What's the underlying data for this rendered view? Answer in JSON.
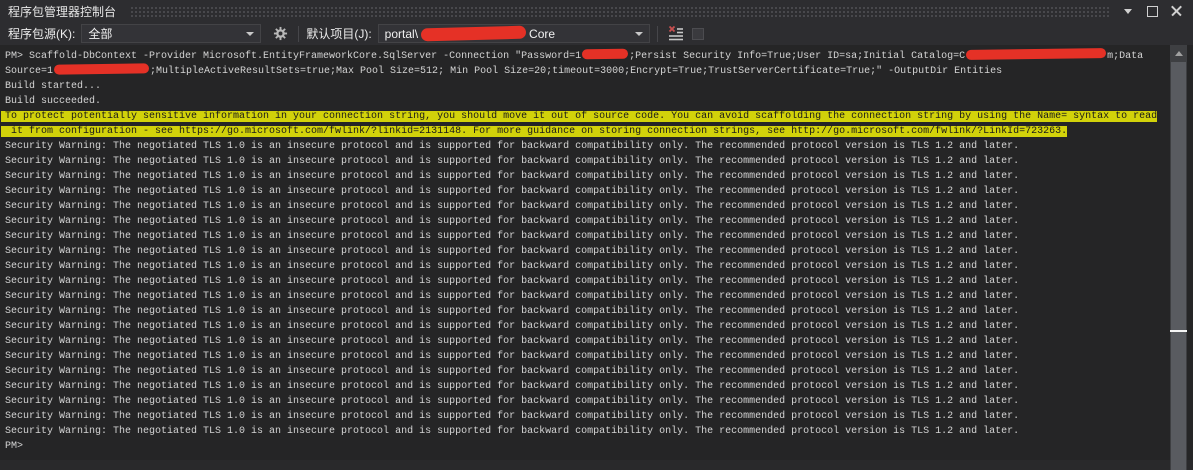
{
  "panel": {
    "title": "程序包管理器控制台"
  },
  "colors": {
    "chrome_bg": "#2d2d30",
    "console_bg": "#252526",
    "console_text": "#d4d4d4",
    "highlight_yellow": "#d2d20a",
    "redaction_red": "#e53126"
  },
  "icons": {
    "titlebar": [
      "window-position-icon",
      "maximize-icon",
      "close-icon"
    ],
    "toolbar": [
      "gear-icon",
      "clear-console-icon",
      "stop-icon"
    ],
    "combobox_arrow": "chevron-down-icon",
    "scrollbar": "scroll-up-icon"
  },
  "toolbar": {
    "package_source_label": "程序包源(K):",
    "package_source_value": "全部",
    "default_project_label": "默认项目(J):",
    "default_project_prefix": "portal\\",
    "default_project_suffix": "Core"
  },
  "console": {
    "lines": [
      {
        "type": "segments",
        "parts": [
          {
            "text": "PM> Scaffold-DbContext -Provider Microsoft.EntityFrameworkCore.SqlServer -Connection \"Password=1"
          },
          {
            "redacted": 46
          },
          {
            "text": ";Persist Security Info=True;User ID=sa;Initial Catalog=C"
          },
          {
            "redacted": 140
          },
          {
            "text": "m;Data"
          }
        ]
      },
      {
        "type": "segments",
        "parts": [
          {
            "text": "Source=1"
          },
          {
            "redacted": 95
          },
          {
            "text": ";MultipleActiveResultSets=true;Max Pool Size=512; Min Pool Size=20;timeout=3000;Encrypt=True;TrustServerCertificate=True;\" -OutputDir Entities"
          }
        ]
      },
      {
        "type": "plain",
        "text": "Build started..."
      },
      {
        "type": "plain",
        "text": "Build succeeded."
      },
      {
        "type": "highlight",
        "text": "To protect potentially sensitive information in your connection string, you should move it out of source code. You can avoid scaffolding the connection string by using the Name= syntax to read"
      },
      {
        "type": "highlight",
        "text": " it from configuration - see https://go.microsoft.com/fwlink/?linkid=2131148. For more guidance on storing connection strings, see http://go.microsoft.com/fwlink/?LinkId=723263."
      },
      {
        "type": "plain",
        "repeat": 20,
        "text": "Security Warning: The negotiated TLS 1.0 is an insecure protocol and is supported for backward compatibility only. The recommended protocol version is TLS 1.2 and later."
      },
      {
        "type": "plain",
        "text": "PM>"
      }
    ]
  }
}
